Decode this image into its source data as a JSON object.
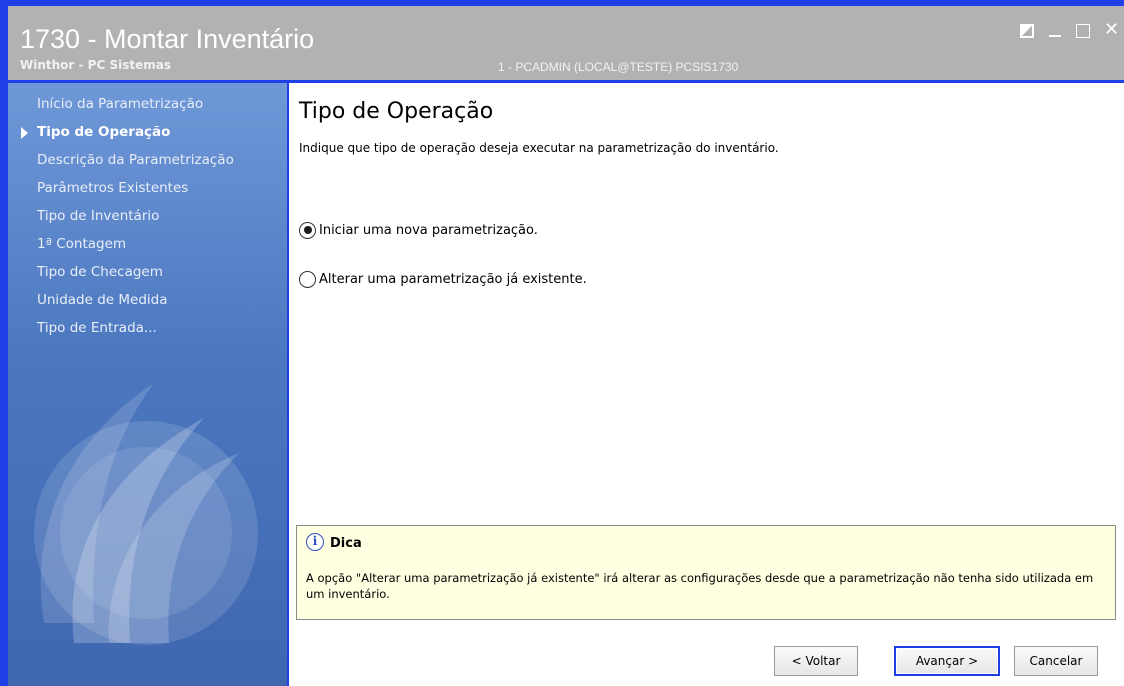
{
  "titlebar": {
    "title": "1730 - Montar Inventário",
    "subtitle": "Winthor - PC Sistemas",
    "user_info": "1 - PCADMIN (LOCAL@TESTE)   PCSIS1730"
  },
  "window_controls": {
    "close_glyph": "✕"
  },
  "sidebar": {
    "items": [
      {
        "label": "Início da Parametrização",
        "active": false
      },
      {
        "label": "Tipo de Operação",
        "active": true
      },
      {
        "label": "Descrição da Parametrização",
        "active": false
      },
      {
        "label": "Parâmetros Existentes",
        "active": false
      },
      {
        "label": "Tipo de Inventário",
        "active": false
      },
      {
        "label": "1ª Contagem",
        "active": false
      },
      {
        "label": "Tipo de Checagem",
        "active": false
      },
      {
        "label": "Unidade de Medida",
        "active": false
      },
      {
        "label": "Tipo de Entrada...",
        "active": false
      }
    ]
  },
  "main": {
    "title": "Tipo de Operação",
    "description": "Indique que tipo de operação deseja executar na  parametrização do inventário.",
    "options": [
      {
        "label": "Iniciar uma nova parametrização.",
        "checked": true
      },
      {
        "label": "Alterar uma parametrização já existente.",
        "checked": false
      }
    ],
    "tip": {
      "icon_glyph": "i",
      "title": "Dica",
      "text": "A opção \"Alterar uma parametrização já existente\" irá alterar as configurações desde que a parametrização não tenha sido utilizada em um inventário."
    }
  },
  "buttons": {
    "back": "< Voltar",
    "next": "Avançar >",
    "cancel": "Cancelar"
  },
  "colors": {
    "window_border": "#1f40e6",
    "titlebar": "#b2b2b2",
    "sidebar_top": "#6f98d8",
    "sidebar_bottom": "#3f67b0",
    "tip_background": "#ffffe1"
  }
}
